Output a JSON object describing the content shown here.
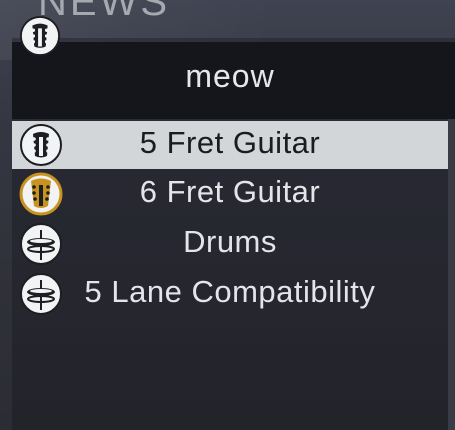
{
  "header": {
    "title": "NEWS",
    "header_icon": "guitar-headstock-icon"
  },
  "profile": {
    "name": "meow"
  },
  "instruments": [
    {
      "label": "5 Fret Guitar",
      "icon": "guitar-headstock-icon",
      "selected": true
    },
    {
      "label": "6 Fret Guitar",
      "icon": "guitar-headstock-gold-icon",
      "selected": false
    },
    {
      "label": "Drums",
      "icon": "drum-cymbal-icon",
      "selected": false
    },
    {
      "label": "5 Lane Compatibility",
      "icon": "drum-cymbal-icon",
      "selected": false
    }
  ],
  "colors": {
    "selected_row": "#d2d6d9",
    "header_bar": "#15161b",
    "gold_accent": "#c9931f"
  }
}
